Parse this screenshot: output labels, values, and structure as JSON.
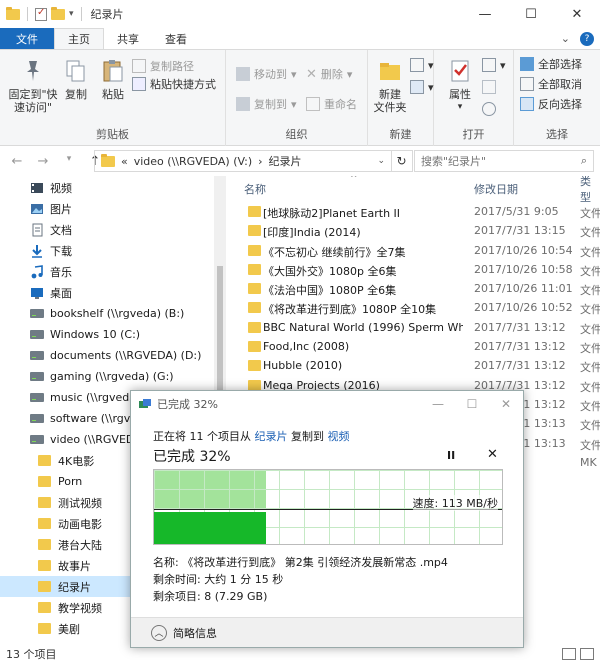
{
  "window": {
    "title": "纪录片",
    "controls": [
      "—",
      "☐",
      "✕"
    ]
  },
  "ribbon_tabs": {
    "file": "文件",
    "home": "主页",
    "share": "共享",
    "view": "查看"
  },
  "ribbon": {
    "clipboard": {
      "label": "剪贴板",
      "pin": "固定到\"快速访问\"",
      "copy": "复制",
      "paste": "粘贴",
      "copy_path": "复制路径",
      "paste_shortcut": "粘贴快捷方式"
    },
    "organize": {
      "label": "组织",
      "move_to": "移动到",
      "copy_to": "复制到",
      "delete": "删除",
      "rename": "重命名"
    },
    "new": {
      "label": "新建",
      "new_folder": "新建\n文件夹"
    },
    "open": {
      "label": "打开",
      "properties": "属性"
    },
    "select": {
      "label": "选择",
      "select_all": "全部选择",
      "select_none": "全部取消",
      "invert": "反向选择"
    }
  },
  "address": {
    "prefix": "«",
    "path": [
      "video (\\\\RGVEDA) (V:)",
      "纪录片"
    ],
    "separator": "›",
    "search_placeholder": "搜索\"纪录片\""
  },
  "nav_pane": {
    "items": [
      {
        "label": "视频",
        "icon": "video-icon",
        "indent": 0,
        "selected": false
      },
      {
        "label": "图片",
        "icon": "pictures-icon",
        "indent": 0,
        "selected": false
      },
      {
        "label": "文档",
        "icon": "documents-icon",
        "indent": 0,
        "selected": false
      },
      {
        "label": "下载",
        "icon": "download-icon",
        "indent": 0,
        "selected": false
      },
      {
        "label": "音乐",
        "icon": "music-icon",
        "indent": 0,
        "selected": false
      },
      {
        "label": "桌面",
        "icon": "desktop-icon",
        "indent": 0,
        "selected": false
      },
      {
        "label": "bookshelf (\\\\rgveda) (B:)",
        "icon": "network-drive-icon",
        "indent": 0,
        "selected": false
      },
      {
        "label": "Windows 10 (C:)",
        "icon": "network-drive-icon",
        "indent": 0,
        "selected": false
      },
      {
        "label": "documents (\\\\RGVEDA) (D:)",
        "icon": "network-drive-icon",
        "indent": 0,
        "selected": false
      },
      {
        "label": "gaming (\\\\rgveda) (G:)",
        "icon": "network-drive-icon",
        "indent": 0,
        "selected": false
      },
      {
        "label": "music (\\\\rgveda) (M:)",
        "icon": "network-drive-icon",
        "indent": 0,
        "selected": false
      },
      {
        "label": "software (\\\\rgve",
        "icon": "network-drive-icon",
        "indent": 0,
        "selected": false
      },
      {
        "label": "video (\\\\RGVEDA)",
        "icon": "network-drive-icon",
        "indent": 0,
        "selected": false
      },
      {
        "label": "4K电影",
        "icon": "folder-icon",
        "indent": 1,
        "selected": false
      },
      {
        "label": "Porn",
        "icon": "folder-icon",
        "indent": 1,
        "selected": false
      },
      {
        "label": "测试视频",
        "icon": "folder-icon",
        "indent": 1,
        "selected": false
      },
      {
        "label": "动画电影",
        "icon": "folder-icon",
        "indent": 1,
        "selected": false
      },
      {
        "label": "港台大陆",
        "icon": "folder-icon",
        "indent": 1,
        "selected": false
      },
      {
        "label": "故事片",
        "icon": "folder-icon",
        "indent": 1,
        "selected": false
      },
      {
        "label": "纪录片",
        "icon": "folder-icon",
        "indent": 1,
        "selected": true
      },
      {
        "label": "教学视频",
        "icon": "folder-icon",
        "indent": 1,
        "selected": false
      },
      {
        "label": "美剧",
        "icon": "folder-icon",
        "indent": 1,
        "selected": false
      }
    ]
  },
  "file_list": {
    "columns": {
      "name": "名称",
      "date": "修改日期",
      "type": "类型"
    },
    "rows": [
      {
        "name": "[地球脉动2]Planet Earth II",
        "date": "2017/5/31 9:05",
        "type": "文件"
      },
      {
        "name": "[印度]India (2014)",
        "date": "2017/7/31 13:15",
        "type": "文件"
      },
      {
        "name": "《不忘初心 继续前行》全7集",
        "date": "2017/10/26 10:54",
        "type": "文件"
      },
      {
        "name": "《大国外交》1080p 全6集",
        "date": "2017/10/26 10:58",
        "type": "文件"
      },
      {
        "name": "《法治中国》1080P 全6集",
        "date": "2017/10/26 11:01",
        "type": "文件"
      },
      {
        "name": "《将改革进行到底》1080P 全10集",
        "date": "2017/10/26 10:52",
        "type": "文件"
      },
      {
        "name": "BBC Natural World (1996) Sperm Wh...",
        "date": "2017/7/31 13:12",
        "type": "文件"
      },
      {
        "name": "Food,Inc (2008)",
        "date": "2017/7/31 13:12",
        "type": "文件"
      },
      {
        "name": "Hubble (2010)",
        "date": "2017/7/31 13:12",
        "type": "文件"
      },
      {
        "name": "Mega Projects (2016)",
        "date": "2017/7/31 13:12",
        "type": "文件"
      },
      {
        "name": "",
        "date": "2017/7/31 13:12",
        "type": "文件"
      },
      {
        "name": "",
        "date": "2017/7/31 13:13",
        "type": "文件"
      },
      {
        "name": "",
        "date": "2017/7/31 13:13",
        "type": "文件"
      },
      {
        "name": "",
        "date": "2:51",
        "type": "MK"
      }
    ]
  },
  "status_bar": {
    "item_count": "13 个项目"
  },
  "copy_dialog": {
    "title": "已完成 32%",
    "line1_prefix": "正在将 11 个项目从",
    "source": "纪录片",
    "line1_middle": "复制到",
    "destination": "视频",
    "progress_text": "已完成 32%",
    "progress_fraction": 0.32,
    "pause": "II",
    "close": "✕",
    "speed": "速度: 113 MB/秒",
    "name_label": "名称:",
    "name_value": "《将改革进行到底》 第2集 引领经济发展新常态 .mp4",
    "time_label": "剩余时间:",
    "time_value": "大约 1 分 15 秒",
    "items_label": "剩余项目:",
    "items_value": "8 (7.29 GB)",
    "details_toggle": "简略信息",
    "accent_fill": "#16b829",
    "accent_light": "#a3e39b"
  }
}
